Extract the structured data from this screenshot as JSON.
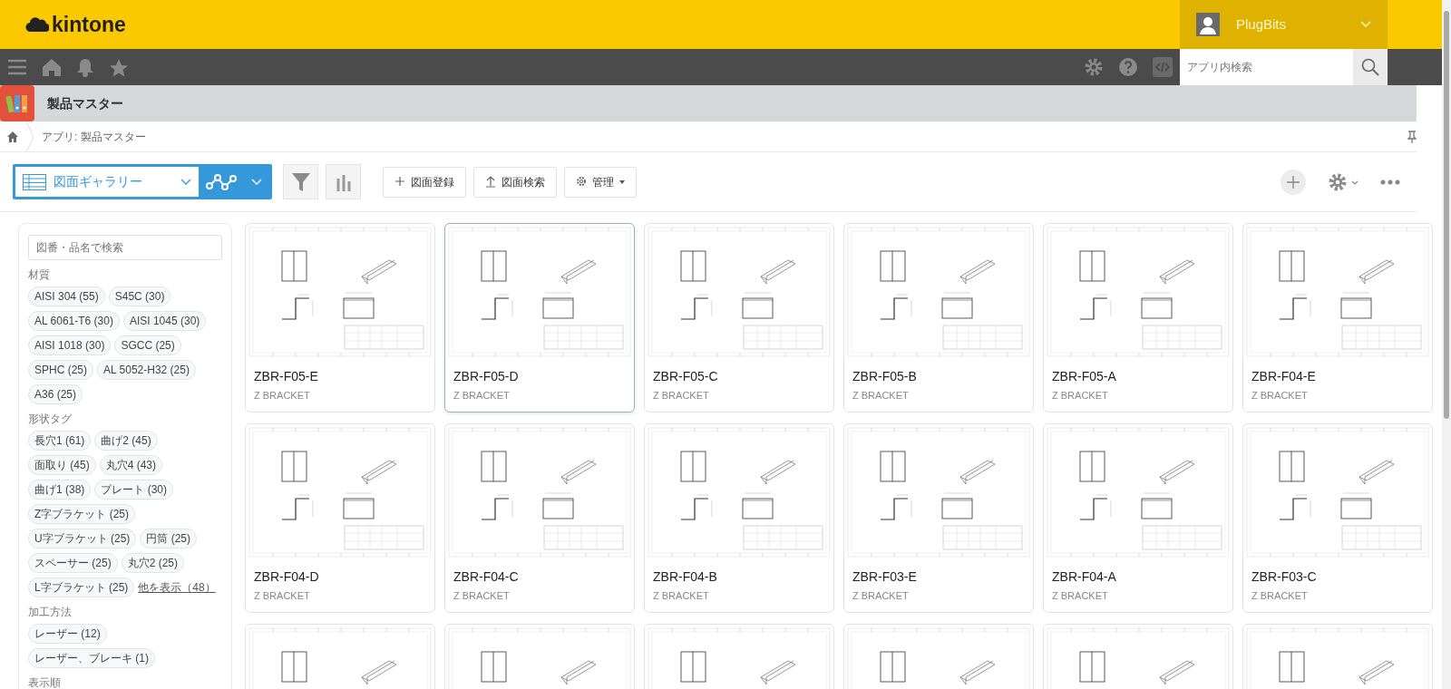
{
  "brand": {
    "name": "kintone"
  },
  "user": {
    "name": "PlugBits"
  },
  "search": {
    "placeholder": "アプリ内検索"
  },
  "app": {
    "title": "製品マスター"
  },
  "breadcrumb": {
    "path": "アプリ: 製品マスター"
  },
  "toolbar": {
    "view": "図面ギャラリー",
    "buttons": [
      {
        "label": "図面登録",
        "kind": "plus"
      },
      {
        "label": "図面検索",
        "kind": "upload"
      },
      {
        "label": "管理",
        "kind": "settings"
      }
    ]
  },
  "filter": {
    "search_placeholder": "図番・品名で検索",
    "groups": [
      {
        "title": "材質",
        "tags": [
          "AISI 304 (55)",
          "S45C (30)",
          "AL 6061-T6 (30)",
          "AISI 1045 (30)",
          "AISI 1018 (30)",
          "SGCC (25)",
          "SPHC (25)",
          "AL 5052-H32 (25)",
          "A36 (25)"
        ]
      },
      {
        "title": "形状タグ",
        "tags": [
          "長穴1 (61)",
          "曲げ2 (45)",
          "面取り (45)",
          "丸穴4 (43)",
          "曲げ1 (38)",
          "プレート (30)",
          "Z字ブラケット (25)",
          "U字ブラケット (25)",
          "円筒 (25)",
          "スペーサー (25)",
          "丸穴2 (25)",
          "L字ブラケット (25)"
        ],
        "more": "他を表示（48）"
      },
      {
        "title": "加工方法",
        "tags": [
          "レーザー (12)",
          "レーザー、ブレーキ (1)"
        ]
      },
      {
        "title": "表示順"
      }
    ]
  },
  "cards": [
    {
      "code": "ZBR-F05-E",
      "name": "Z BRACKET",
      "selected": false
    },
    {
      "code": "ZBR-F05-D",
      "name": "Z BRACKET",
      "selected": true
    },
    {
      "code": "ZBR-F05-C",
      "name": "Z BRACKET",
      "selected": false
    },
    {
      "code": "ZBR-F05-B",
      "name": "Z BRACKET",
      "selected": false
    },
    {
      "code": "ZBR-F05-A",
      "name": "Z BRACKET",
      "selected": false
    },
    {
      "code": "ZBR-F04-E",
      "name": "Z BRACKET",
      "selected": false
    },
    {
      "code": "ZBR-F04-D",
      "name": "Z BRACKET",
      "selected": false
    },
    {
      "code": "ZBR-F04-C",
      "name": "Z BRACKET",
      "selected": false
    },
    {
      "code": "ZBR-F04-B",
      "name": "Z BRACKET",
      "selected": false
    },
    {
      "code": "ZBR-F03-E",
      "name": "Z BRACKET",
      "selected": false
    },
    {
      "code": "ZBR-F04-A",
      "name": "Z BRACKET",
      "selected": false
    },
    {
      "code": "ZBR-F03-C",
      "name": "Z BRACKET",
      "selected": false
    },
    {
      "selected": false
    },
    {
      "selected": false
    },
    {
      "selected": false
    },
    {
      "selected": false
    },
    {
      "selected": false
    },
    {
      "selected": false
    }
  ]
}
